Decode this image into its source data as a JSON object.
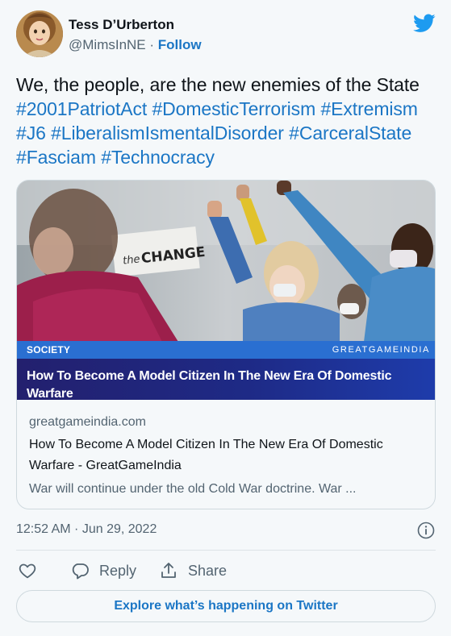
{
  "author": {
    "display_name": "Tess D’Urberton",
    "handle": "@MimsInNE",
    "separator": " · ",
    "follow_label": "Follow"
  },
  "tweet": {
    "text_plain": "We, the people, are the new enemies of the State ",
    "hashtags": [
      "#2001PatriotAct",
      "#DomesticTerrorism",
      "#Extremism",
      "#J6",
      "#LiberalismIsmentalDisorder",
      "#CarceralState",
      "#Fasciam",
      "#Technocracy"
    ]
  },
  "card": {
    "image_sign_text": "CHANGE",
    "image_sign_prefix": "the",
    "section": "SOCIETY",
    "brand": "GREATGAMEINDIA",
    "headline": "How To Become A Model Citizen In The New Era Of Domestic Warfare",
    "domain": "greatgameindia.com",
    "title": "How To Become A Model Citizen In The New Era Of Domestic Warfare - GreatGameIndia",
    "description": "War will continue under the old Cold War doctrine. War ..."
  },
  "meta": {
    "timestamp": "12:52 AM · Jun 29, 2022"
  },
  "actions": {
    "reply_label": "Reply",
    "share_label": "Share"
  },
  "explore": {
    "label": "Explore what’s happening on Twitter"
  },
  "icons": {
    "brand": "twitter-bird-icon",
    "info": "info-icon",
    "like": "heart-icon",
    "reply": "speech-bubble-icon",
    "share": "upload-icon"
  },
  "colors": {
    "link": "#1b76c5",
    "text": "#0f1419",
    "muted": "#536471",
    "background": "#f5f8fa",
    "twitter_blue": "#1d9bf0",
    "banner_blue": "#2a6fd1",
    "banner_navy": "#23206e"
  }
}
